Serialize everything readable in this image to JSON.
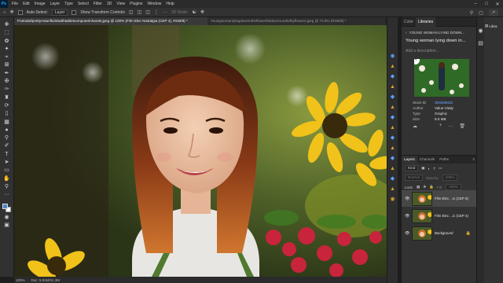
{
  "menubar": {
    "logo": "Ps",
    "items": [
      "File",
      "Edit",
      "Image",
      "Layer",
      "Type",
      "Select",
      "Filter",
      "3D",
      "View",
      "Plugins",
      "Window",
      "Help"
    ]
  },
  "options_bar": {
    "auto_select_label": "Auto-Select:",
    "auto_select_value": "Layer",
    "show_transform_label": "Show Transform Controls",
    "mode_3d_label": "3D Mode:"
  },
  "document_tabs": [
    {
      "label": "PortraitofprettyAsianfloristwithtabletcomputerinhands.jpeg @ 100% (Film Elec Nostalgia (CEP 4), RGB/8) *",
      "active": true
    },
    {
      "label": "Youngwomanlyingdownintheflowerfieldsurroundedbyflowers.jpeg @ 72.8% (RGB/8) *",
      "active": false
    }
  ],
  "status_bar": {
    "zoom": "100%",
    "doc_info": "Doc: 5.91M/11.3M"
  },
  "libraries_panel": {
    "tabs": [
      "Color",
      "Libraries"
    ],
    "back_label": "YOUNG WOMAN LYING DOWN...",
    "asset_title": "Young woman lying down in...",
    "description_placeholder": "Add a description...",
    "meta": [
      {
        "key": "Stock ID",
        "value": "393288832"
      },
      {
        "key": "Author",
        "value": "Value Vitaly"
      },
      {
        "key": "Type",
        "value": "Graphic"
      },
      {
        "key": "Size",
        "value": "8.6 MB"
      }
    ]
  },
  "layers_panel": {
    "tabs": [
      "Layers",
      "Channels",
      "Paths"
    ],
    "filter_kind": "Kind",
    "blend_mode": "Normal",
    "opacity_label": "Opacity:",
    "opacity_value": "100%",
    "lock_label": "Lock:",
    "fill_label": "Fill:",
    "fill_value": "100%",
    "layers": [
      {
        "name": "Film Elec ...ic (CEP 6)",
        "selected": true,
        "italic": false
      },
      {
        "name": "Film Elec ...ic (CEP 4)",
        "selected": false,
        "italic": false
      },
      {
        "name": "Background",
        "selected": false,
        "italic": true
      }
    ]
  },
  "right_panel": {
    "label": "Libra"
  },
  "colors": {
    "accent": "#31a8ff",
    "foreground_swatch": "#4a86c8",
    "background_swatch": "#ffffff"
  }
}
